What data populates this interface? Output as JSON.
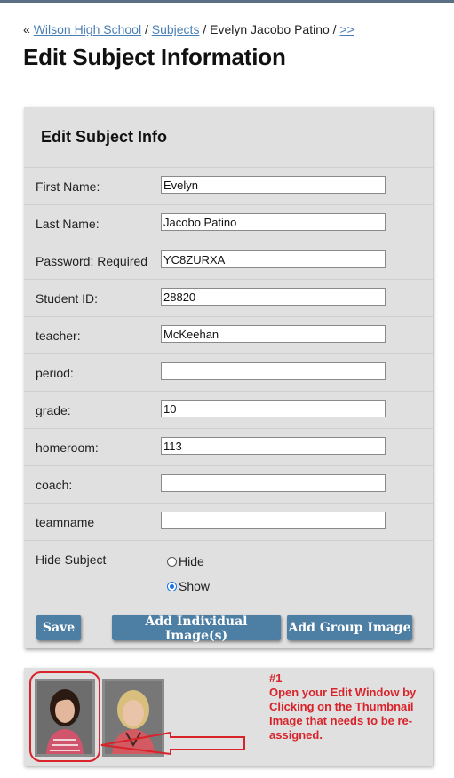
{
  "breadcrumb": {
    "prefix": "«",
    "school": "Wilson High School",
    "sep1": "/",
    "subjects": "Subjects",
    "sep2": "/",
    "current": "Evelyn Jacobo Patino",
    "sep3": "/",
    "next": ">>"
  },
  "page_title": "Edit Subject Information",
  "form": {
    "heading": "Edit Subject Info",
    "fields": [
      {
        "label": "First Name:",
        "value": "Evelyn"
      },
      {
        "label": "Last Name:",
        "value": "Jacobo Patino"
      },
      {
        "label": "Password: Required",
        "value": "YC8ZURXA"
      },
      {
        "label": "Student ID:",
        "value": "28820"
      },
      {
        "label": "teacher:",
        "value": "McKeehan"
      },
      {
        "label": "period:",
        "value": ""
      },
      {
        "label": "grade:",
        "value": "10"
      },
      {
        "label": "homeroom:",
        "value": "113"
      },
      {
        "label": "coach:",
        "value": ""
      },
      {
        "label": "teamname",
        "value": ""
      }
    ],
    "hide_subject": {
      "label": "Hide Subject",
      "options": [
        "Hide",
        "Show"
      ],
      "selected": "Show"
    },
    "buttons": {
      "save": "Save",
      "add_individual": "Add Individual Image(s)",
      "add_group": "Add Group Image"
    }
  },
  "annotation": {
    "number": "#1",
    "text": "Open your Edit Window by Clicking on the Thumbnail Image that needs to be re-assigned."
  },
  "colors": {
    "panel_bg": "#e0e0e0",
    "button_bg": "#4d7ea3",
    "link": "#4a7fb5",
    "annotation": "#d8232a"
  }
}
